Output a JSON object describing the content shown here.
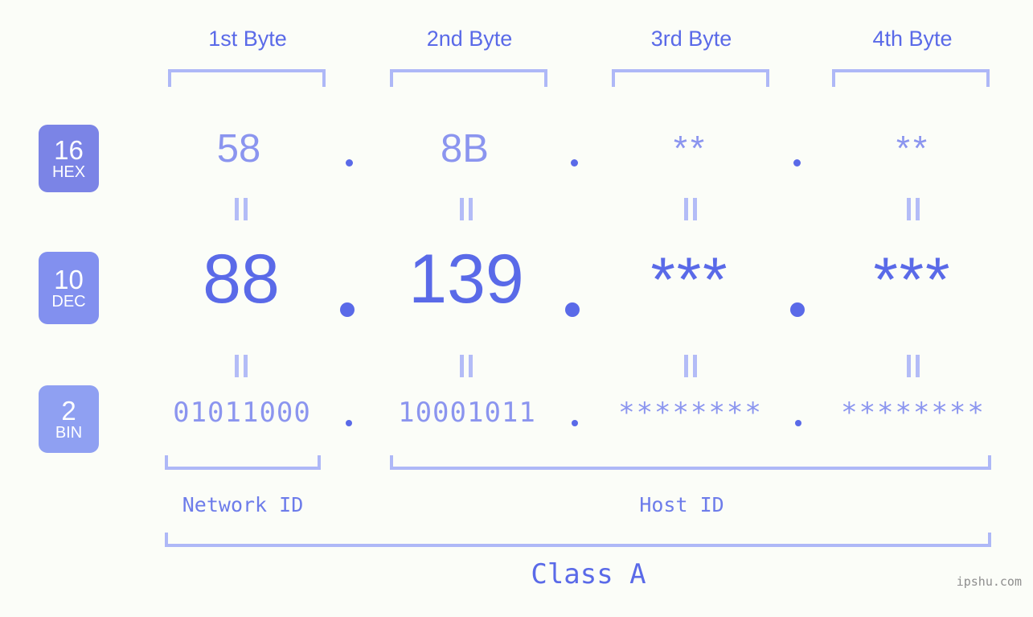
{
  "background_color": "#fbfdf8",
  "accent_strong": "#5a6ae8",
  "accent_mid": "#8b95ef",
  "accent_light": "#aeb8f7",
  "byte_headers": [
    {
      "label": "1st Byte"
    },
    {
      "label": "2nd Byte"
    },
    {
      "label": "3rd Byte"
    },
    {
      "label": "4th Byte"
    }
  ],
  "bases": [
    {
      "number": "16",
      "name": "HEX",
      "color": "#7b84e6"
    },
    {
      "number": "10",
      "name": "DEC",
      "color": "#8290ef"
    },
    {
      "number": "2",
      "name": "BIN",
      "color": "#8fa0f2"
    }
  ],
  "rows": {
    "hex": {
      "values": [
        "58",
        "8B",
        "**",
        "**"
      ],
      "separator": "."
    },
    "dec": {
      "values": [
        "88",
        "139",
        "***",
        "***"
      ],
      "separator": "."
    },
    "bin": {
      "values": [
        "01011000",
        "10001011",
        "********",
        "********"
      ],
      "separator": "."
    }
  },
  "equals_symbol": "=",
  "footer": {
    "network_id": "Network ID",
    "host_id": "Host ID",
    "class": "Class A"
  },
  "watermark": "ipshu.com",
  "chart_data": {
    "type": "table",
    "title": "IP address byte breakdown",
    "columns": [
      "1st Byte",
      "2nd Byte",
      "3rd Byte",
      "4th Byte"
    ],
    "rows": [
      {
        "base": "16 HEX",
        "values": [
          "58",
          "8B",
          "**",
          "**"
        ]
      },
      {
        "base": "10 DEC",
        "values": [
          "88",
          "139",
          "***",
          "***"
        ]
      },
      {
        "base": "2 BIN",
        "values": [
          "01011000",
          "10001011",
          "********",
          "********"
        ]
      }
    ],
    "annotations": {
      "network_id_span": [
        "1st Byte"
      ],
      "host_id_span": [
        "2nd Byte",
        "3rd Byte",
        "4th Byte"
      ],
      "class_span": [
        "1st Byte",
        "2nd Byte",
        "3rd Byte",
        "4th Byte"
      ],
      "class": "Class A"
    }
  }
}
